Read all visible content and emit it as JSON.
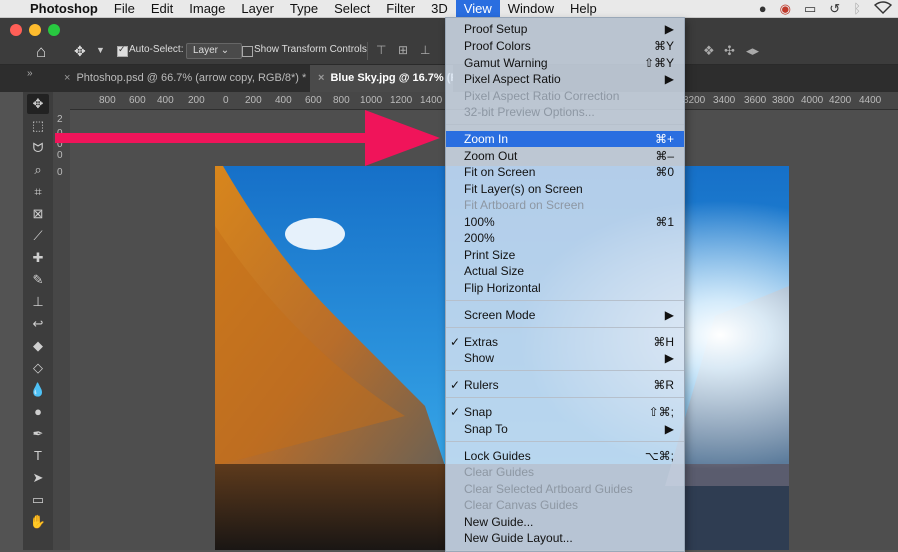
{
  "menubar": {
    "app_name": "Photoshop",
    "items": [
      "File",
      "Edit",
      "Image",
      "Layer",
      "Type",
      "Select",
      "Filter",
      "3D",
      "View",
      "Window",
      "Help"
    ]
  },
  "options_bar": {
    "auto_select_label": "Auto-Select:",
    "auto_select_target": "Layer",
    "show_transform_label": "Show Transform Controls"
  },
  "tabs": [
    {
      "label": "Phtoshop.psd @ 66.7% (arrow copy, RGB/8*) *"
    },
    {
      "label": "Blue Sky.jpg @ 16.7% (R"
    }
  ],
  "ruler_h": [
    "800",
    "600",
    "400",
    "200",
    "0",
    "200",
    "400",
    "600",
    "800",
    "1000",
    "1200",
    "1400",
    "3200",
    "3400",
    "3600",
    "3800",
    "4000",
    "4200",
    "4400"
  ],
  "ruler_v": [
    "2",
    "0",
    "0",
    "0",
    "0"
  ],
  "view_menu": {
    "items": [
      {
        "label": "Proof Setup",
        "shortcut": "▶",
        "checked": "",
        "disabled": false,
        "highlighted": false
      },
      {
        "label": "Proof Colors",
        "shortcut": "⌘Y",
        "checked": "",
        "disabled": false,
        "highlighted": false
      },
      {
        "label": "Gamut Warning",
        "shortcut": "⇧⌘Y",
        "checked": "",
        "disabled": false,
        "highlighted": false
      },
      {
        "label": "Pixel Aspect Ratio",
        "shortcut": "▶",
        "checked": "",
        "disabled": false,
        "highlighted": false
      },
      {
        "label": "Pixel Aspect Ratio Correction",
        "shortcut": "",
        "checked": "",
        "disabled": true,
        "highlighted": false
      },
      {
        "label": "32-bit Preview Options...",
        "shortcut": "",
        "checked": "",
        "disabled": true,
        "highlighted": false
      },
      {
        "label": "Zoom In",
        "shortcut": "⌘+",
        "checked": "",
        "disabled": false,
        "highlighted": true
      },
      {
        "label": "Zoom Out",
        "shortcut": "⌘–",
        "checked": "",
        "disabled": false,
        "highlighted": false
      },
      {
        "label": "Fit on Screen",
        "shortcut": "⌘0",
        "checked": "",
        "disabled": false,
        "highlighted": false
      },
      {
        "label": "Fit Layer(s) on Screen",
        "shortcut": "",
        "checked": "",
        "disabled": false,
        "highlighted": false
      },
      {
        "label": "Fit Artboard on Screen",
        "shortcut": "",
        "checked": "",
        "disabled": true,
        "highlighted": false
      },
      {
        "label": "100%",
        "shortcut": "⌘1",
        "checked": "",
        "disabled": false,
        "highlighted": false
      },
      {
        "label": "200%",
        "shortcut": "",
        "checked": "",
        "disabled": false,
        "highlighted": false
      },
      {
        "label": "Print Size",
        "shortcut": "",
        "checked": "",
        "disabled": false,
        "highlighted": false
      },
      {
        "label": "Actual Size",
        "shortcut": "",
        "checked": "",
        "disabled": false,
        "highlighted": false
      },
      {
        "label": "Flip Horizontal",
        "shortcut": "",
        "checked": "",
        "disabled": false,
        "highlighted": false
      },
      {
        "label": "Screen Mode",
        "shortcut": "▶",
        "checked": "",
        "disabled": false,
        "highlighted": false
      },
      {
        "label": "Extras",
        "shortcut": "⌘H",
        "checked": "✓",
        "disabled": false,
        "highlighted": false
      },
      {
        "label": "Show",
        "shortcut": "▶",
        "checked": "",
        "disabled": false,
        "highlighted": false
      },
      {
        "label": "Rulers",
        "shortcut": "⌘R",
        "checked": "✓",
        "disabled": false,
        "highlighted": false
      },
      {
        "label": "Snap",
        "shortcut": "⇧⌘;",
        "checked": "✓",
        "disabled": false,
        "highlighted": false
      },
      {
        "label": "Snap To",
        "shortcut": "▶",
        "checked": "",
        "disabled": false,
        "highlighted": false
      },
      {
        "label": "Lock Guides",
        "shortcut": "⌥⌘;",
        "checked": "",
        "disabled": false,
        "highlighted": false
      },
      {
        "label": "Clear Guides",
        "shortcut": "",
        "checked": "",
        "disabled": true,
        "highlighted": false
      },
      {
        "label": "Clear Selected Artboard Guides",
        "shortcut": "",
        "checked": "",
        "disabled": true,
        "highlighted": false
      },
      {
        "label": "Clear Canvas Guides",
        "shortcut": "",
        "checked": "",
        "disabled": true,
        "highlighted": false
      },
      {
        "label": "New Guide...",
        "shortcut": "",
        "checked": "",
        "disabled": false,
        "highlighted": false
      },
      {
        "label": "New Guide Layout...",
        "shortcut": "",
        "checked": "",
        "disabled": false,
        "highlighted": false
      }
    ]
  },
  "tools": [
    "move-tool",
    "marquee-tool",
    "lasso-tool",
    "quick-select-tool",
    "crop-tool",
    "frame-tool",
    "eyedropper-tool",
    "healing-brush-tool",
    "brush-tool",
    "clone-stamp-tool",
    "history-brush-tool",
    "eraser-tool",
    "paint-bucket-tool",
    "blur-tool",
    "dodge-tool",
    "pen-tool",
    "type-tool",
    "path-select-tool",
    "shape-tool",
    "hand-tool"
  ],
  "colors": {
    "menu_highlight": "#2a6ee0",
    "arrow": "#f0145a",
    "sky": "#1a8fe0"
  }
}
